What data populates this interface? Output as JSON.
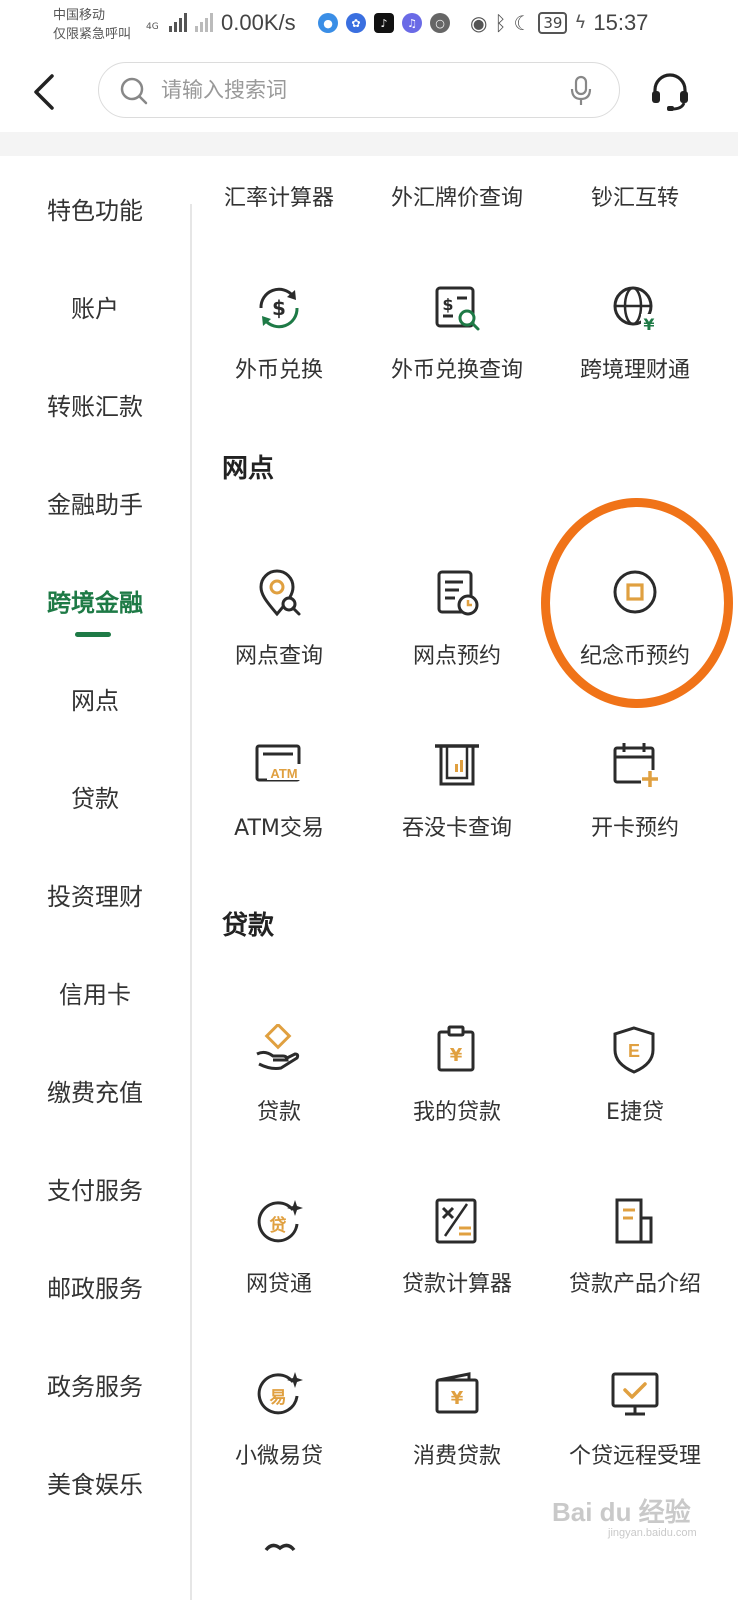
{
  "status_bar": {
    "carrier_line1": "中国移动",
    "carrier_line2": "仅限紧急呼叫",
    "net_type": "4G",
    "speed": "0.00K/s",
    "battery": "39",
    "time": "15:37"
  },
  "header": {
    "search_placeholder": "请输入搜索词"
  },
  "sidebar": {
    "items": [
      {
        "label": "特色功能"
      },
      {
        "label": "账户"
      },
      {
        "label": "转账汇款"
      },
      {
        "label": "金融助手"
      },
      {
        "label": "跨境金融",
        "active": true
      },
      {
        "label": "网点"
      },
      {
        "label": "贷款"
      },
      {
        "label": "投资理财"
      },
      {
        "label": "信用卡"
      },
      {
        "label": "缴费充值"
      },
      {
        "label": "支付服务"
      },
      {
        "label": "邮政服务"
      },
      {
        "label": "政务服务"
      },
      {
        "label": "美食娱乐"
      }
    ]
  },
  "top_row": [
    {
      "label": "汇率计算器"
    },
    {
      "label": "外汇牌价查询"
    },
    {
      "label": "钞汇互转"
    }
  ],
  "cross_border": [
    {
      "label": "外币兑换",
      "icon": "currency-exchange-icon"
    },
    {
      "label": "外币兑换查询",
      "icon": "exchange-query-icon"
    },
    {
      "label": "跨境理财通",
      "icon": "globe-yuan-icon"
    }
  ],
  "sections": {
    "branch_title": "网点",
    "loan_title": "贷款"
  },
  "branch": [
    {
      "label": "网点查询",
      "icon": "location-search-icon"
    },
    {
      "label": "网点预约",
      "icon": "document-clock-icon"
    },
    {
      "label": "纪念币预约",
      "icon": "coin-icon"
    },
    {
      "label": "ATM交易",
      "icon": "atm-icon"
    },
    {
      "label": "吞没卡查询",
      "icon": "card-slot-icon"
    },
    {
      "label": "开卡预约",
      "icon": "calendar-plus-icon"
    }
  ],
  "loan": [
    {
      "label": "贷款",
      "icon": "hand-coin-icon"
    },
    {
      "label": "我的贷款",
      "icon": "clipboard-yuan-icon"
    },
    {
      "label": "E捷贷",
      "icon": "shield-e-icon"
    },
    {
      "label": "网贷通",
      "icon": "loan-badge-icon"
    },
    {
      "label": "贷款计算器",
      "icon": "calculator-icon"
    },
    {
      "label": "贷款产品介绍",
      "icon": "document-icon"
    },
    {
      "label": "小微易贷",
      "icon": "easy-loan-icon"
    },
    {
      "label": "消费贷款",
      "icon": "wallet-yuan-icon"
    },
    {
      "label": "个贷远程受理",
      "icon": "monitor-check-icon"
    }
  ],
  "watermark": {
    "text": "Bai du 经验",
    "sub": "jingyan.baidu.com"
  },
  "colors": {
    "accent_green": "#1e7a46",
    "icon_dark": "#2b2b2b",
    "icon_gold": "#e0a040",
    "highlight_orange": "#f07318"
  }
}
